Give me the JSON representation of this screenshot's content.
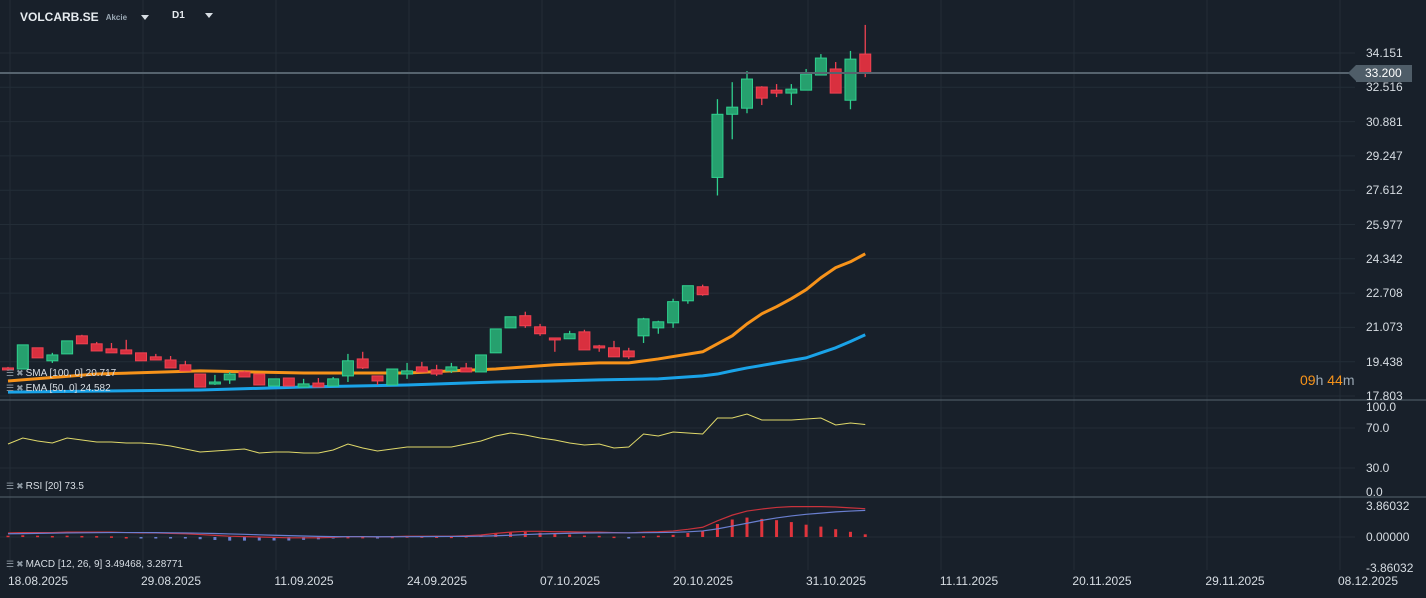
{
  "header": {
    "symbol": "VOLCARB.SE",
    "instrument_type": "Akcie",
    "timeframe": "D1"
  },
  "colors": {
    "background": "#18202a",
    "up": "#26a06e",
    "down": "#d9303f",
    "ema": "#f7931a",
    "sma": "#1aa3e8",
    "rsi": "#e0d96a",
    "macd": "#c8323c",
    "macd_signal": "#6a7fd0",
    "grid": "#232d37",
    "current_price_line": "#56636e"
  },
  "current_price": "33.200",
  "countdown": {
    "hours": "09",
    "h_unit": "h",
    "minutes": "44",
    "m_unit": "m"
  },
  "price_axis": [
    "34.151",
    "32.516",
    "30.881",
    "29.247",
    "27.612",
    "25.977",
    "24.342",
    "22.708",
    "21.073",
    "19.438",
    "17.803"
  ],
  "rsi_axis": [
    "100.0",
    "70.0",
    "30.0",
    "0.0"
  ],
  "macd_axis": [
    "3.86032",
    "0.00000",
    "-3.86032"
  ],
  "date_axis": [
    "18.08.2025",
    "29.08.2025",
    "11.09.2025",
    "24.09.2025",
    "07.10.2025",
    "20.10.2025",
    "31.10.2025",
    "11.11.2025",
    "20.11.2025",
    "29.11.2025",
    "08.12.2025"
  ],
  "indicators": {
    "sma": {
      "label": "SMA [100, 0] 20.717"
    },
    "ema": {
      "label": "EMA [50, 0] 24.582"
    },
    "rsi": {
      "label": "RSI [20] 73.5"
    },
    "macd": {
      "label": "MACD [12, 26, 9] 3.49468, 3.28771"
    }
  },
  "chart_data": {
    "type": "candlestick",
    "columns": [
      "date",
      "open",
      "high",
      "low",
      "close"
    ],
    "candles": [
      [
        "14.08.2025",
        19.14,
        19.19,
        19.0,
        19.05
      ],
      [
        "15.08.2025",
        19.09,
        20.24,
        19.09,
        20.24
      ],
      [
        "18.08.2025",
        20.1,
        20.1,
        19.62,
        19.62
      ],
      [
        "19.08.2025",
        19.48,
        19.86,
        19.38,
        19.76
      ],
      [
        "20.08.2025",
        19.81,
        20.43,
        19.81,
        20.43
      ],
      [
        "21.08.2025",
        20.67,
        20.72,
        20.29,
        20.29
      ],
      [
        "22.08.2025",
        20.29,
        20.38,
        19.95,
        19.95
      ],
      [
        "25.08.2025",
        20.05,
        20.33,
        19.86,
        19.86
      ],
      [
        "26.08.2025",
        20.0,
        20.48,
        19.81,
        19.81
      ],
      [
        "27.08.2025",
        19.86,
        19.86,
        19.48,
        19.48
      ],
      [
        "28.08.2025",
        19.67,
        19.81,
        19.52,
        19.52
      ],
      [
        "29.08.2025",
        19.52,
        19.71,
        19.14,
        19.14
      ],
      [
        "01.09.2025",
        19.29,
        19.48,
        19.0,
        19.0
      ],
      [
        "02.09.2025",
        18.85,
        18.85,
        18.23,
        18.23
      ],
      [
        "03.09.2025",
        18.38,
        18.81,
        18.33,
        18.47
      ],
      [
        "04.09.2025",
        18.57,
        18.95,
        18.38,
        18.85
      ],
      [
        "05.09.2025",
        18.95,
        19.0,
        18.71,
        18.71
      ],
      [
        "08.09.2025",
        18.85,
        18.85,
        18.33,
        18.33
      ],
      [
        "09.09.2025",
        18.28,
        18.62,
        18.28,
        18.62
      ],
      [
        "10.09.2025",
        18.66,
        18.66,
        18.28,
        18.28
      ],
      [
        "11.09.2025",
        18.23,
        18.62,
        18.23,
        18.38
      ],
      [
        "12.09.2025",
        18.42,
        18.66,
        18.23,
        18.23
      ],
      [
        "15.09.2025",
        18.28,
        18.71,
        18.28,
        18.62
      ],
      [
        "16.09.2025",
        18.76,
        19.81,
        18.47,
        19.48
      ],
      [
        "17.09.2025",
        19.57,
        19.91,
        19.09,
        19.14
      ],
      [
        "18.09.2025",
        18.76,
        18.76,
        18.33,
        18.52
      ],
      [
        "19.09.2025",
        18.33,
        19.09,
        18.33,
        19.09
      ],
      [
        "22.09.2025",
        18.85,
        19.38,
        18.62,
        19.0
      ],
      [
        "23.09.2025",
        19.19,
        19.43,
        18.95,
        18.95
      ],
      [
        "24.09.2025",
        19.05,
        19.29,
        18.76,
        18.85
      ],
      [
        "25.09.2025",
        19.0,
        19.38,
        18.9,
        19.19
      ],
      [
        "26.09.2025",
        19.14,
        19.38,
        18.95,
        18.95
      ],
      [
        "29.09.2025",
        18.95,
        19.76,
        18.95,
        19.76
      ],
      [
        "30.09.2025",
        19.86,
        21.0,
        19.86,
        21.0
      ],
      [
        "01.10.2025",
        21.05,
        21.58,
        21.05,
        21.58
      ],
      [
        "02.10.2025",
        21.63,
        21.82,
        21.05,
        21.15
      ],
      [
        "03.10.2025",
        21.1,
        21.24,
        20.67,
        20.77
      ],
      [
        "06.10.2025",
        20.57,
        20.57,
        19.91,
        20.48
      ],
      [
        "07.10.2025",
        20.53,
        20.91,
        20.53,
        20.77
      ],
      [
        "08.10.2025",
        20.86,
        20.96,
        20.0,
        20.0
      ],
      [
        "09.10.2025",
        20.19,
        20.24,
        19.91,
        20.1
      ],
      [
        "10.10.2025",
        20.1,
        20.43,
        19.67,
        19.67
      ],
      [
        "13.10.2025",
        19.95,
        20.1,
        19.57,
        19.67
      ],
      [
        "14.10.2025",
        20.67,
        21.53,
        20.33,
        21.48
      ],
      [
        "15.10.2025",
        21.05,
        21.39,
        20.77,
        21.34
      ],
      [
        "16.10.2025",
        21.29,
        22.44,
        21.05,
        22.3
      ],
      [
        "17.10.2025",
        22.34,
        23.06,
        22.2,
        23.06
      ],
      [
        "20.10.2025",
        23.01,
        23.11,
        22.58,
        22.63
      ],
      [
        "21.10.2025",
        28.22,
        31.95,
        27.36,
        31.23
      ],
      [
        "22.10.2025",
        31.23,
        32.76,
        30.04,
        31.57
      ],
      [
        "23.10.2025",
        31.52,
        33.29,
        31.28,
        32.91
      ],
      [
        "24.10.2025",
        32.53,
        32.57,
        31.67,
        32.0
      ],
      [
        "27.10.2025",
        32.38,
        32.67,
        32.05,
        32.24
      ],
      [
        "28.10.2025",
        32.24,
        32.67,
        31.67,
        32.43
      ],
      [
        "29.10.2025",
        32.38,
        33.39,
        32.38,
        33.15
      ],
      [
        "30.10.2025",
        33.1,
        34.1,
        33.1,
        33.91
      ],
      [
        "31.10.2025",
        33.39,
        33.72,
        32.24,
        32.24
      ],
      [
        "03.11.2025",
        31.9,
        34.25,
        31.47,
        33.86
      ],
      [
        "04.11.2025",
        34.1,
        35.49,
        33.0,
        33.2
      ]
    ],
    "ema_50": [
      [
        "14.08.2025",
        18.52
      ],
      [
        "22.08.2025",
        18.85
      ],
      [
        "02.09.2025",
        19.0
      ],
      [
        "11.09.2025",
        18.9
      ],
      [
        "22.09.2025",
        18.9
      ],
      [
        "25.09.2025",
        19.0
      ],
      [
        "30.09.2025",
        19.09
      ],
      [
        "06.10.2025",
        19.29
      ],
      [
        "09.10.2025",
        19.38
      ],
      [
        "13.10.2025",
        19.38
      ],
      [
        "15.10.2025",
        19.57
      ],
      [
        "20.10.2025",
        19.91
      ],
      [
        "22.10.2025",
        20.67
      ],
      [
        "23.10.2025",
        21.24
      ],
      [
        "24.10.2025",
        21.72
      ],
      [
        "27.10.2025",
        22.06
      ],
      [
        "28.10.2025",
        22.44
      ],
      [
        "29.10.2025",
        22.87
      ],
      [
        "30.10.2025",
        23.44
      ],
      [
        "31.10.2025",
        23.92
      ],
      [
        "03.11.2025",
        24.2
      ],
      [
        "04.11.2025",
        24.58
      ]
    ],
    "sma_100": [
      [
        "14.08.2025",
        17.99
      ],
      [
        "02.09.2025",
        18.09
      ],
      [
        "11.09.2025",
        18.23
      ],
      [
        "22.09.2025",
        18.33
      ],
      [
        "30.09.2025",
        18.47
      ],
      [
        "06.10.2025",
        18.52
      ],
      [
        "09.10.2025",
        18.57
      ],
      [
        "15.10.2025",
        18.62
      ],
      [
        "20.10.2025",
        18.76
      ],
      [
        "21.10.2025",
        18.85
      ],
      [
        "22.10.2025",
        19.0
      ],
      [
        "23.10.2025",
        19.14
      ],
      [
        "27.10.2025",
        19.38
      ],
      [
        "29.10.2025",
        19.62
      ],
      [
        "30.10.2025",
        19.86
      ],
      [
        "31.10.2025",
        20.1
      ],
      [
        "03.11.2025",
        20.4
      ],
      [
        "04.11.2025",
        20.72
      ]
    ],
    "rsi": [
      54,
      60,
      57,
      55,
      60,
      58,
      56,
      56,
      55,
      55,
      54,
      52,
      49,
      46,
      47,
      48,
      49,
      45,
      46,
      46,
      45,
      45,
      48,
      54,
      50,
      47,
      49,
      51,
      51,
      51,
      51,
      54,
      57,
      62,
      65,
      63,
      60,
      58,
      55,
      53,
      54,
      50,
      51,
      64,
      62,
      66,
      65,
      64,
      80,
      80,
      84,
      78,
      78,
      78,
      79,
      80,
      73,
      75,
      73.5
    ],
    "rsi_levels": [
      70,
      30
    ],
    "macd": [
      0.5,
      0.55,
      0.55,
      0.55,
      0.6,
      0.6,
      0.6,
      0.6,
      0.55,
      0.5,
      0.5,
      0.45,
      0.4,
      0.3,
      0.2,
      0.1,
      0.05,
      0.0,
      -0.05,
      -0.1,
      -0.1,
      -0.1,
      -0.05,
      0.05,
      0.05,
      0.0,
      0.05,
      0.1,
      0.1,
      0.1,
      0.1,
      0.15,
      0.25,
      0.45,
      0.6,
      0.7,
      0.7,
      0.65,
      0.65,
      0.6,
      0.6,
      0.55,
      0.5,
      0.6,
      0.65,
      0.75,
      0.95,
      1.2,
      2.0,
      2.7,
      3.2,
      3.45,
      3.65,
      3.75,
      3.75,
      3.75,
      3.7,
      3.6,
      3.49468
    ],
    "macd_signal": [
      0.4,
      0.42,
      0.45,
      0.47,
      0.5,
      0.52,
      0.53,
      0.55,
      0.55,
      0.55,
      0.54,
      0.52,
      0.5,
      0.47,
      0.43,
      0.38,
      0.33,
      0.27,
      0.22,
      0.17,
      0.12,
      0.08,
      0.05,
      0.04,
      0.04,
      0.03,
      0.03,
      0.04,
      0.05,
      0.06,
      0.07,
      0.08,
      0.1,
      0.15,
      0.22,
      0.3,
      0.37,
      0.42,
      0.46,
      0.49,
      0.51,
      0.52,
      0.52,
      0.53,
      0.55,
      0.58,
      0.64,
      0.75,
      1.0,
      1.35,
      1.7,
      2.05,
      2.35,
      2.6,
      2.8,
      2.95,
      3.1,
      3.2,
      3.28771
    ],
    "price_range": [
      17.803,
      34.151
    ],
    "rsi_range": [
      0,
      100
    ],
    "macd_range": [
      -3.86032,
      3.86032
    ],
    "grid": true
  }
}
